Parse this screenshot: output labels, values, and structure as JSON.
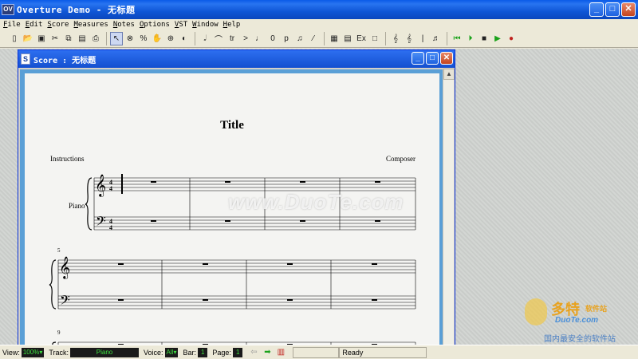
{
  "app": {
    "title": "Overture Demo - 无标题",
    "icon_label": "OV"
  },
  "menu": [
    "File",
    "Edit",
    "Score",
    "Measures",
    "Notes",
    "Options",
    "VST",
    "Window",
    "Help"
  ],
  "toolbar": {
    "groups": [
      [
        "new-document-icon",
        "open-folder-icon",
        "save-icon",
        "cut-icon",
        "copy-icon",
        "paste-icon",
        "print-icon"
      ],
      [
        "pointer-icon",
        "eraser-icon",
        "percent-icon",
        "hand-icon",
        "zoom-icon",
        "speaker-icon"
      ],
      [
        "half-note-icon",
        "tie-icon",
        "trill-icon",
        "accent-icon",
        "quarter-note-icon",
        "zero-icon",
        "p-dynamic-icon",
        "beamed-notes-icon",
        "slur-icon"
      ],
      [
        "keyboard-icon",
        "spreadsheet-icon",
        "expression-icon",
        "box-icon"
      ],
      [
        "treble-clef-icon",
        "treble-clef-alt-icon",
        "barline-icon",
        "double-note-icon"
      ],
      [
        "rewind-icon",
        "play-from-start-icon",
        "stop-icon",
        "play-icon",
        "record-icon"
      ]
    ]
  },
  "score_window": {
    "title": "Score : 无标题",
    "icon_label": "S",
    "doc_title": "Title",
    "instructions": "Instructions",
    "composer": "Composer",
    "instrument": "Piano",
    "measure_numbers": [
      "5",
      "9"
    ],
    "watermark": "www.DuoTe.com"
  },
  "status": {
    "view_label": "View:",
    "view_value": "100%",
    "track_label": "Track:",
    "track_value": "Piano",
    "voice_label": "Voice:",
    "voice_value": "All",
    "bar_label": "Bar:",
    "bar_value": "1",
    "page_label": "Page:",
    "page_value": "1",
    "status_text": "Ready"
  },
  "corner_logo": {
    "cn_text": "多特",
    "cn_small": "软件站",
    "en_text": "DuoTe.com",
    "tagline": "国内最安全的软件站"
  }
}
